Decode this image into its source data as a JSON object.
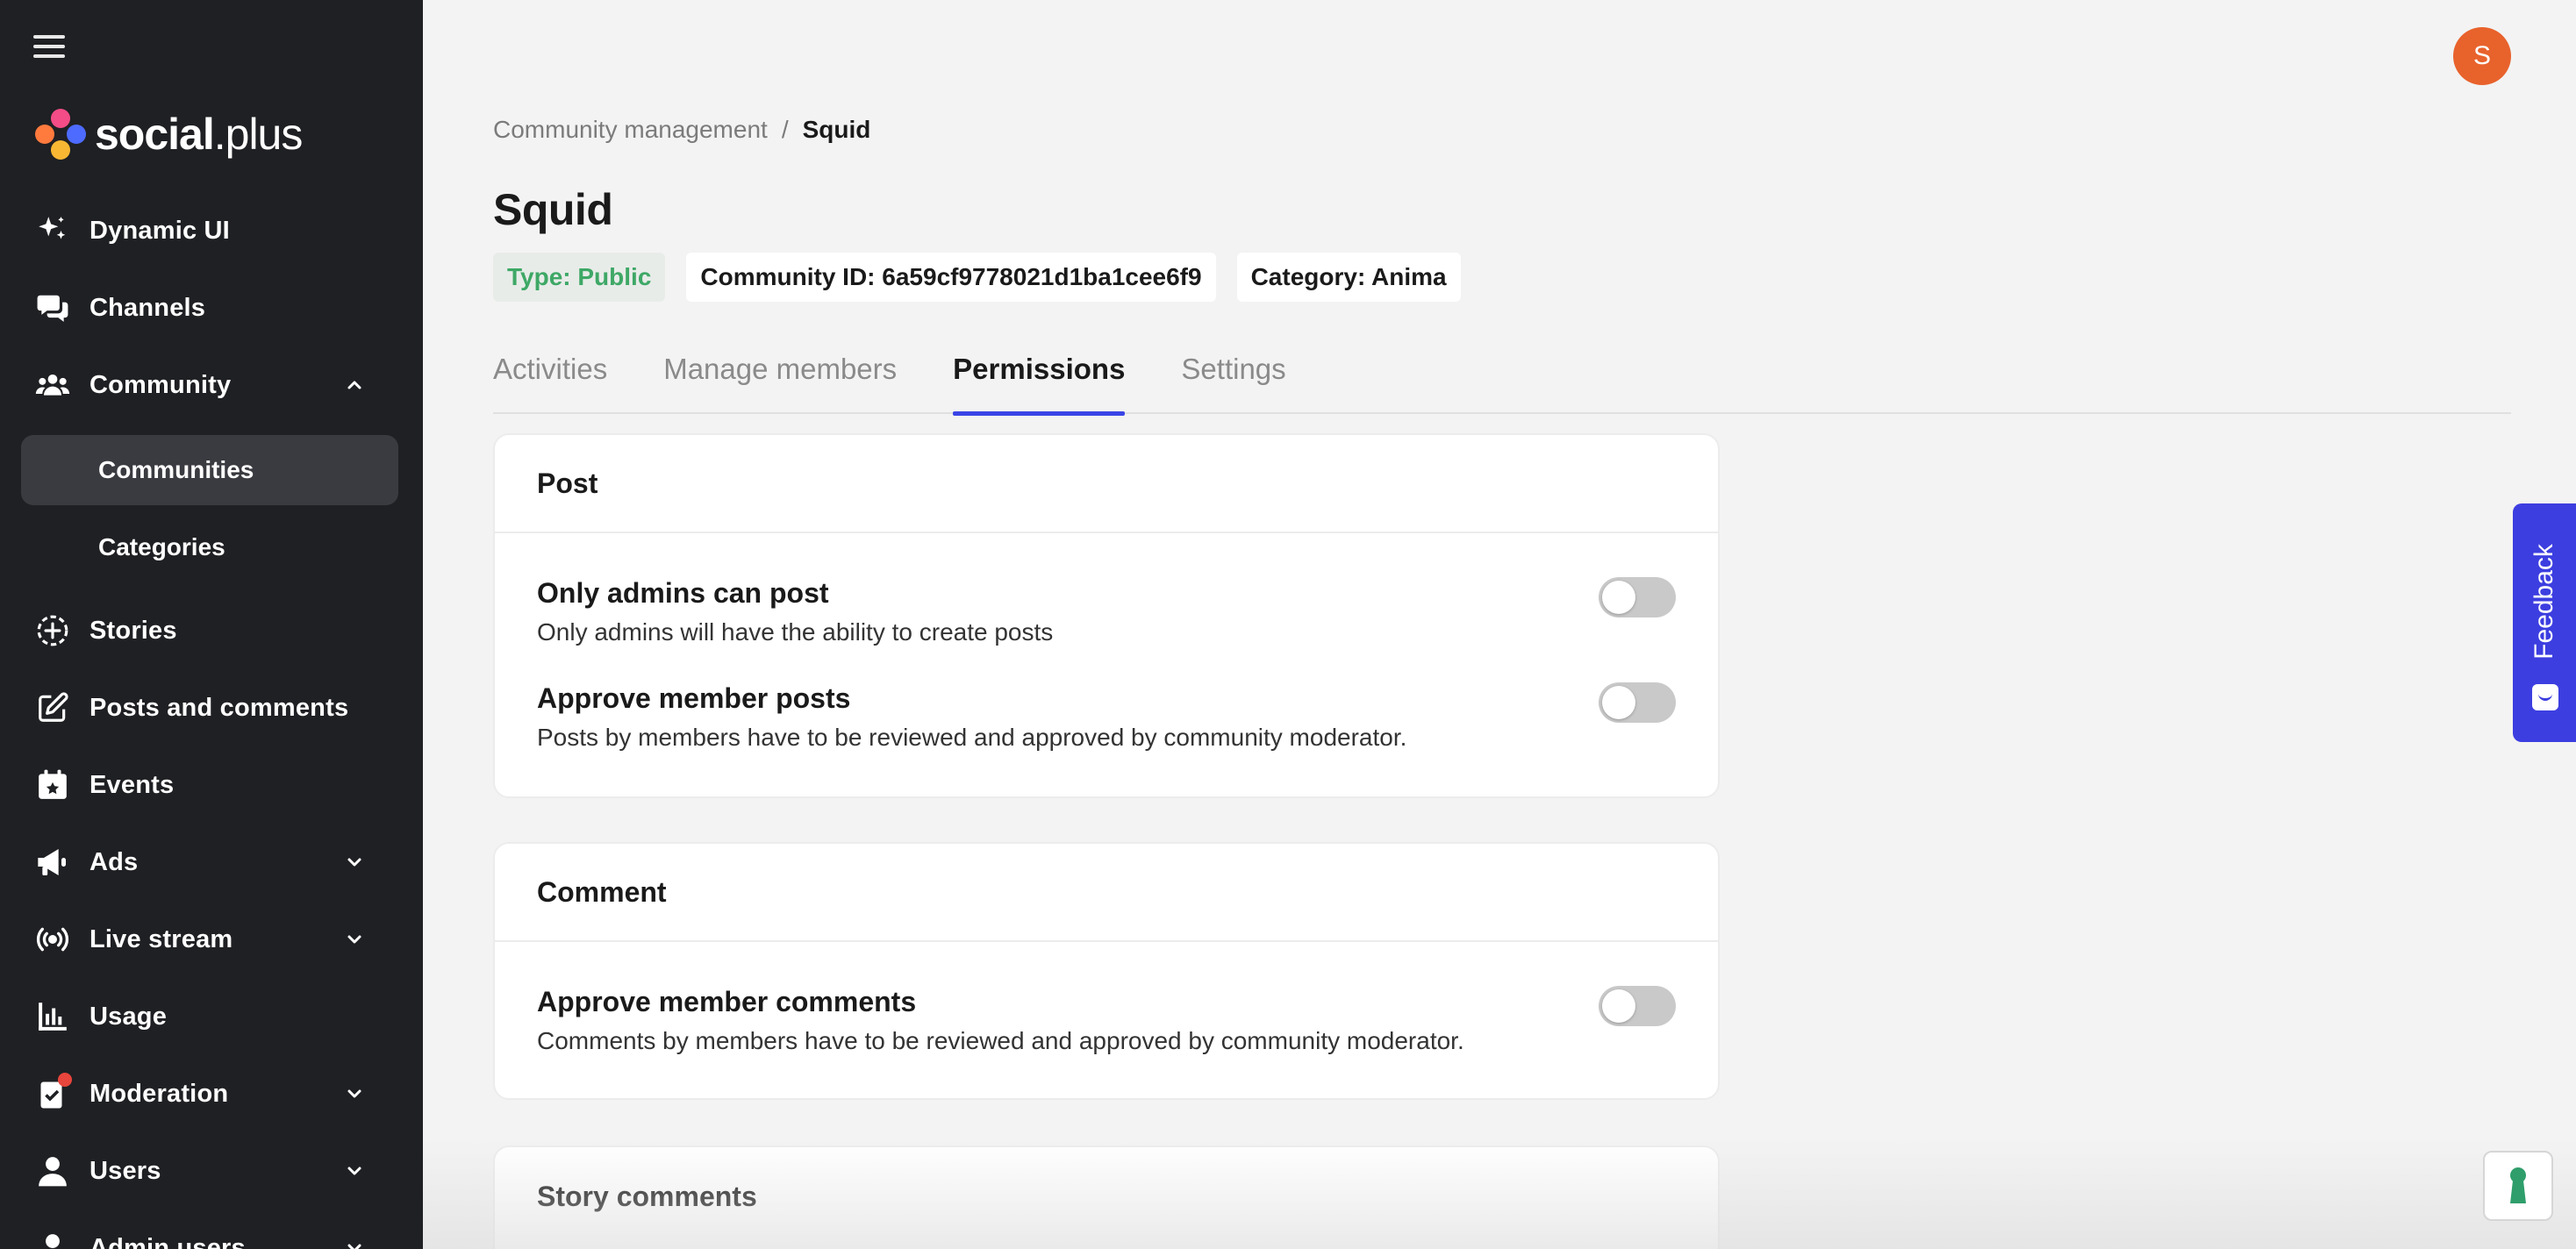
{
  "brand": {
    "logo_bold": "social",
    "logo_light": ".plus"
  },
  "sidebar": {
    "items": [
      {
        "label": "Dynamic UI",
        "icon": "sparkles-icon"
      },
      {
        "label": "Channels",
        "icon": "chat-bubbles-icon"
      },
      {
        "label": "Community",
        "icon": "people-icon",
        "expanded": true
      },
      {
        "label": "Stories",
        "icon": "plus-circle-dashed-icon"
      },
      {
        "label": "Posts and comments",
        "icon": "edit-icon"
      },
      {
        "label": "Events",
        "icon": "calendar-star-icon"
      },
      {
        "label": "Ads",
        "icon": "megaphone-icon"
      },
      {
        "label": "Live stream",
        "icon": "broadcast-icon"
      },
      {
        "label": "Usage",
        "icon": "bar-chart-icon"
      },
      {
        "label": "Moderation",
        "icon": "clipboard-check-icon",
        "badge": true
      },
      {
        "label": "Users",
        "icon": "user-icon"
      },
      {
        "label": "Admin users",
        "icon": "admin-user-icon"
      }
    ],
    "community_sub": [
      "Communities",
      "Categories"
    ]
  },
  "avatar": {
    "initial": "S",
    "color": "#e8622c"
  },
  "breadcrumb": {
    "parent": "Community management",
    "separator": "/",
    "current": "Squid"
  },
  "title": "Squid",
  "tags": {
    "type": "Type: Public",
    "community_id": "Community ID: 6a59cf9778021d1ba1cee6f9",
    "category": "Category: Anima"
  },
  "tabs": [
    "Activities",
    "Manage members",
    "Permissions",
    "Settings"
  ],
  "active_tab": "Permissions",
  "sections": {
    "post": {
      "title": "Post",
      "perms": [
        {
          "title": "Only admins can post",
          "desc": "Only admins will have the ability to create posts",
          "enabled": false
        },
        {
          "title": "Approve member posts",
          "desc": "Posts by members have to be reviewed and approved by community moderator.",
          "enabled": false
        }
      ]
    },
    "comment": {
      "title": "Comment",
      "perms": [
        {
          "title": "Approve member comments",
          "desc": "Comments by members have to be reviewed and approved by community moderator.",
          "enabled": false
        }
      ]
    },
    "story_comments": {
      "title": "Story comments"
    }
  },
  "feedback": "Feedback",
  "colors": {
    "accent": "#3a44e6",
    "sidebar_bg": "#1f2023",
    "public_green": "#3ea866",
    "feedback_bg": "#3c3ee0"
  }
}
